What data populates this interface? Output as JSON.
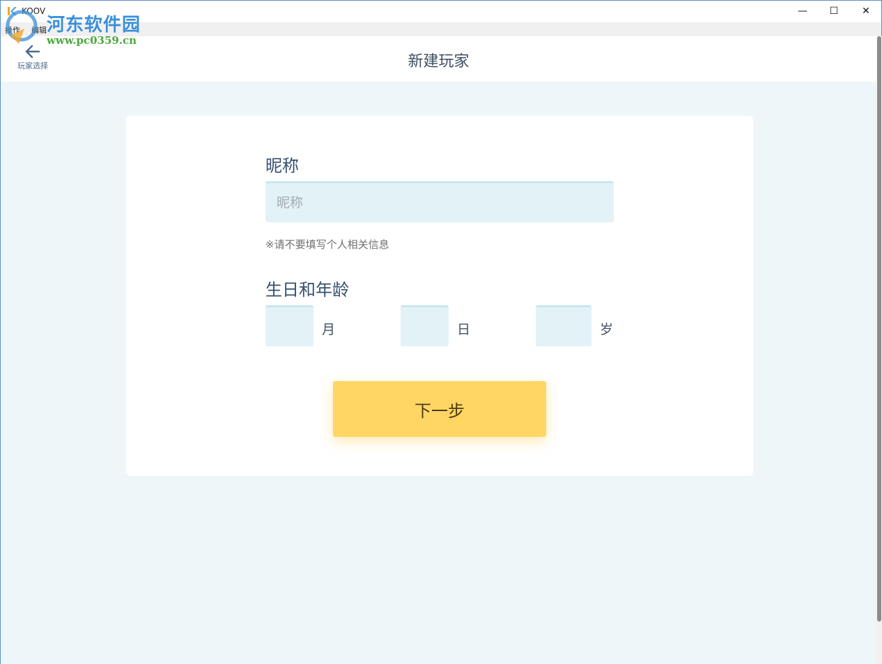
{
  "window": {
    "title": "KOOV",
    "min_glyph": "—",
    "max_glyph": "☐",
    "close_glyph": "✕"
  },
  "menu": {
    "items": [
      "操作",
      "编辑"
    ]
  },
  "watermark": {
    "brand": "河东软件园",
    "url": "www.pc0359.cn"
  },
  "header": {
    "back_label": "玩家选择",
    "back_icon": "arrow-left-icon",
    "title": "新建玩家"
  },
  "form": {
    "nickname_label": "昵称",
    "nickname_placeholder": "昵称",
    "nickname_value": "",
    "hint": "※请不要填写个人相关信息",
    "birthday_label": "生日和年龄",
    "month_unit": "月",
    "day_unit": "日",
    "age_unit": "岁",
    "month_value": "",
    "day_value": "",
    "age_value": "",
    "next_label": "下一步"
  },
  "colors": {
    "accent": "#ffd664",
    "input_bg": "#e2f2f7",
    "content_bg": "#eef6f9",
    "text": "#36506e"
  }
}
